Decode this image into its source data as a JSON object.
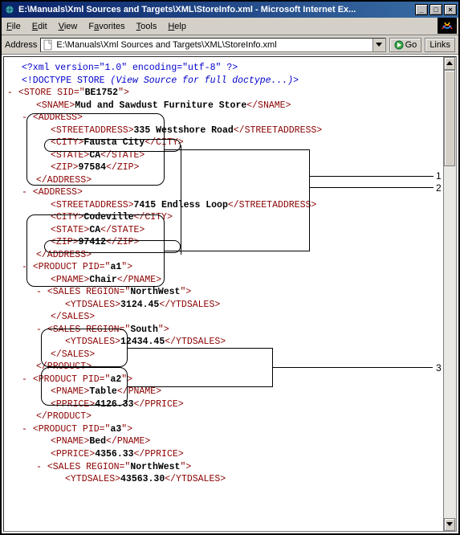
{
  "window": {
    "title": "E:\\Manuals\\Xml Sources and Targets\\XML\\StoreInfo.xml - Microsoft Internet Ex...",
    "min": "_",
    "max": "□",
    "close": "×"
  },
  "menu": {
    "file": "File",
    "edit": "Edit",
    "view": "View",
    "favorites": "Favorites",
    "tools": "Tools",
    "help": "Help"
  },
  "addressbar": {
    "label": "Address",
    "value": "E:\\Manuals\\Xml Sources and Targets\\XML\\StoreInfo.xml",
    "go": "Go",
    "links": "Links"
  },
  "xml": {
    "pi": "<?xml version=\"1.0\" encoding=\"utf-8\" ?>",
    "doctype_pre": "<!DOCTYPE STORE ",
    "doctype_comment": "(View Source for full doctype...)",
    "doctype_post": ">",
    "store_open1": "<STORE SID=\"",
    "store_sid": "BE1752",
    "store_open2": "\">",
    "sname_open": "<SNAME>",
    "sname": "Mud and Sawdust Furniture Store",
    "sname_close": "</SNAME>",
    "address_open": "<ADDRESS>",
    "address_close": "</ADDRESS>",
    "streetaddress_open": "<STREETADDRESS>",
    "streetaddress_close": "</STREETADDRESS>",
    "addr1_street": "335 Westshore Road",
    "city_open": "<CITY>",
    "city_close": "</CITY>",
    "addr1_city": "Fausta City",
    "state_open": "<STATE>",
    "state_close": "</STATE>",
    "addr1_state": "CA",
    "zip_open": "<ZIP>",
    "zip_close": "</ZIP>",
    "addr1_zip": "97584",
    "addr2_street": "7415 Endless Loop",
    "addr2_city": "Codeville",
    "addr2_state": "CA",
    "addr2_zip": "97412",
    "product_open1": "<PRODUCT PID=\"",
    "product_open2": "\">",
    "product_close": "</PRODUCT>",
    "prod1_pid": "a1",
    "pname_open": "<PNAME>",
    "pname_close": "</PNAME>",
    "prod1_name": "Chair",
    "sales_open1": "<SALES REGION=\"",
    "sales_open2": "\">",
    "sales_close": "</SALES>",
    "sales1_region": "NorthWest",
    "ytd_open": "<YTDSALES>",
    "ytd_close": "</YTDSALES>",
    "sales1_ytd": "3124.45",
    "sales2_region": "South",
    "sales2_ytd": "12434.45",
    "prod2_pid": "a2",
    "prod2_name": "Table",
    "pprice_open": "<PPRICE>",
    "pprice_close": "</PPRICE>",
    "prod2_price": "4126.33",
    "prod3_pid": "a3",
    "prod3_name": "Bed",
    "prod3_price": "4356.33",
    "sales3_region": "NorthWest",
    "sales3_ytd": "43563.30",
    "minus": "- "
  },
  "callouts": {
    "c1": "1",
    "c2": "2",
    "c3": "3"
  }
}
